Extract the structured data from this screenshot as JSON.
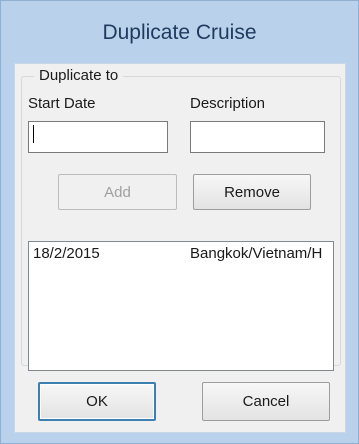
{
  "window": {
    "title": "Duplicate Cruise"
  },
  "group": {
    "legend": "Duplicate to",
    "start_date_label": "Start Date",
    "start_date_value": "",
    "description_label": "Description",
    "description_value": "",
    "add_label": "Add",
    "remove_label": "Remove",
    "list": [
      {
        "date": "18/2/2015",
        "description": "Bangkok/Vietnam/H"
      }
    ]
  },
  "footer": {
    "ok_label": "OK",
    "cancel_label": "Cancel"
  },
  "colors": {
    "frame": "#b9d1ea",
    "client": "#f0f0f0",
    "title_text": "#1e3a5f",
    "default_button_border": "#3c7fb1"
  }
}
